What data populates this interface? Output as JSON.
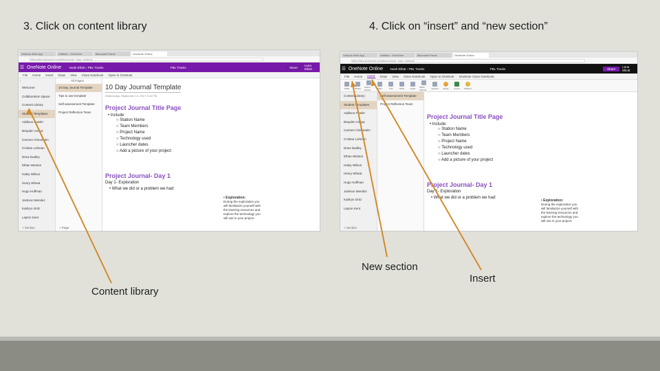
{
  "left_step": {
    "title": "3. Click on content library"
  },
  "right_step": {
    "title": "4. Click on “insert” and “new section”"
  },
  "callouts": {
    "content_library": "Content library",
    "new_section": "New section",
    "insert": "Insert"
  },
  "colors": {
    "onenote_purple": "#7719aa",
    "heading_purple": "#8a4fc0",
    "arrow": "#d48a2c",
    "selected": "#e3d5c1"
  },
  "browser": {
    "left_tabs": [
      "Outlook Web App",
      "Untitled - OneDrive",
      "Microsoft Forms",
      "OneNote Online"
    ],
    "right_tabs": [
      "Outlook Web App",
      "Untitled - OneDrive",
      "Microsoft Forms",
      "OneNote Online"
    ],
    "left_url": "https://sites.sharepoint.com/sites/onenote_class_notebook",
    "right_url": "https://sites.sharepoint.com/sites/onenote_class_notebook"
  },
  "app": {
    "name": "OneNote Online",
    "left_crumb": "Noah Elliott › PBL Tracks",
    "left_doc": "PBL Tracks",
    "right_crumb": "Noah Elliott › PBL Tracks",
    "right_doc": "PBL Tracks",
    "share": "Share",
    "user": "Lena Elliott"
  },
  "ribbon": {
    "tabs": [
      "File",
      "Home",
      "Insert",
      "Draw",
      "View",
      "Class Notebook",
      "Open in OneNote",
      "OneNote Class Notebook"
    ],
    "insert_items": [
      "Table",
      "Picture",
      "Online Picture",
      "Files",
      "Link",
      "Video",
      "Audio",
      "Office Add-ins",
      "Symbol",
      "Emoji",
      "Forms",
      "Stickers"
    ]
  },
  "left_shot": {
    "search": "All Pages",
    "sections": [
      "Welcome",
      "Collaboration Space",
      "Content Library",
      "Student Templates",
      "Addison Fowler",
      "Brayden Anaya",
      "Carmen Cheveatim",
      "Cristian Lohman",
      "Drew Dudley",
      "Ethan Weston",
      "Haley Wilson",
      "Henry Wheat",
      "Hugo Huffman",
      "Jackson Mendez",
      "Kathryn Ortiz",
      "Layton Kent"
    ],
    "selected_section": 3,
    "pages": [
      "10 Day Journal Template",
      "Tips to use template",
      "Self-assessment Template",
      "Project Reflection Team"
    ],
    "selected_page": 0,
    "add_section": "+ Section",
    "add_page": "+ Page"
  },
  "right_shot": {
    "sections": [
      "Content Library",
      "Student Templates",
      "Addison Fowler",
      "Brayden Anaya",
      "Carmen Cheveatim",
      "Cristian Lohman",
      "Drew Dudley",
      "Ethan Weston",
      "Haley Wilson",
      "Henry Wheat",
      "Hugo Huffman",
      "Jackson Mendez",
      "Kathryn Ortiz",
      "Layton Kent"
    ],
    "selected_section": 1,
    "pages": [
      "Self-assessment Template",
      "Project Reflection Team"
    ],
    "add_section": "+ Section"
  },
  "page": {
    "title": "10 Day Journal Template",
    "date": "Wednesday, September 13, 2017   3:24 PM",
    "heading1": "Project Journal Title Page",
    "include": "• Include:",
    "items": [
      "Station Name",
      "Team Members",
      "Project Name",
      "Technology used",
      "Launcher dates",
      "Add a picture of your project"
    ],
    "heading2": "Project Journal- Day 1",
    "day_label": "Day 1- Exploration",
    "question": "•  What we did or a problem we had:",
    "explore_title": "• Exploration:",
    "explore_text": "During the exploration you will familiarize yourself with the learning resources and explore the technology you will use in your project."
  }
}
